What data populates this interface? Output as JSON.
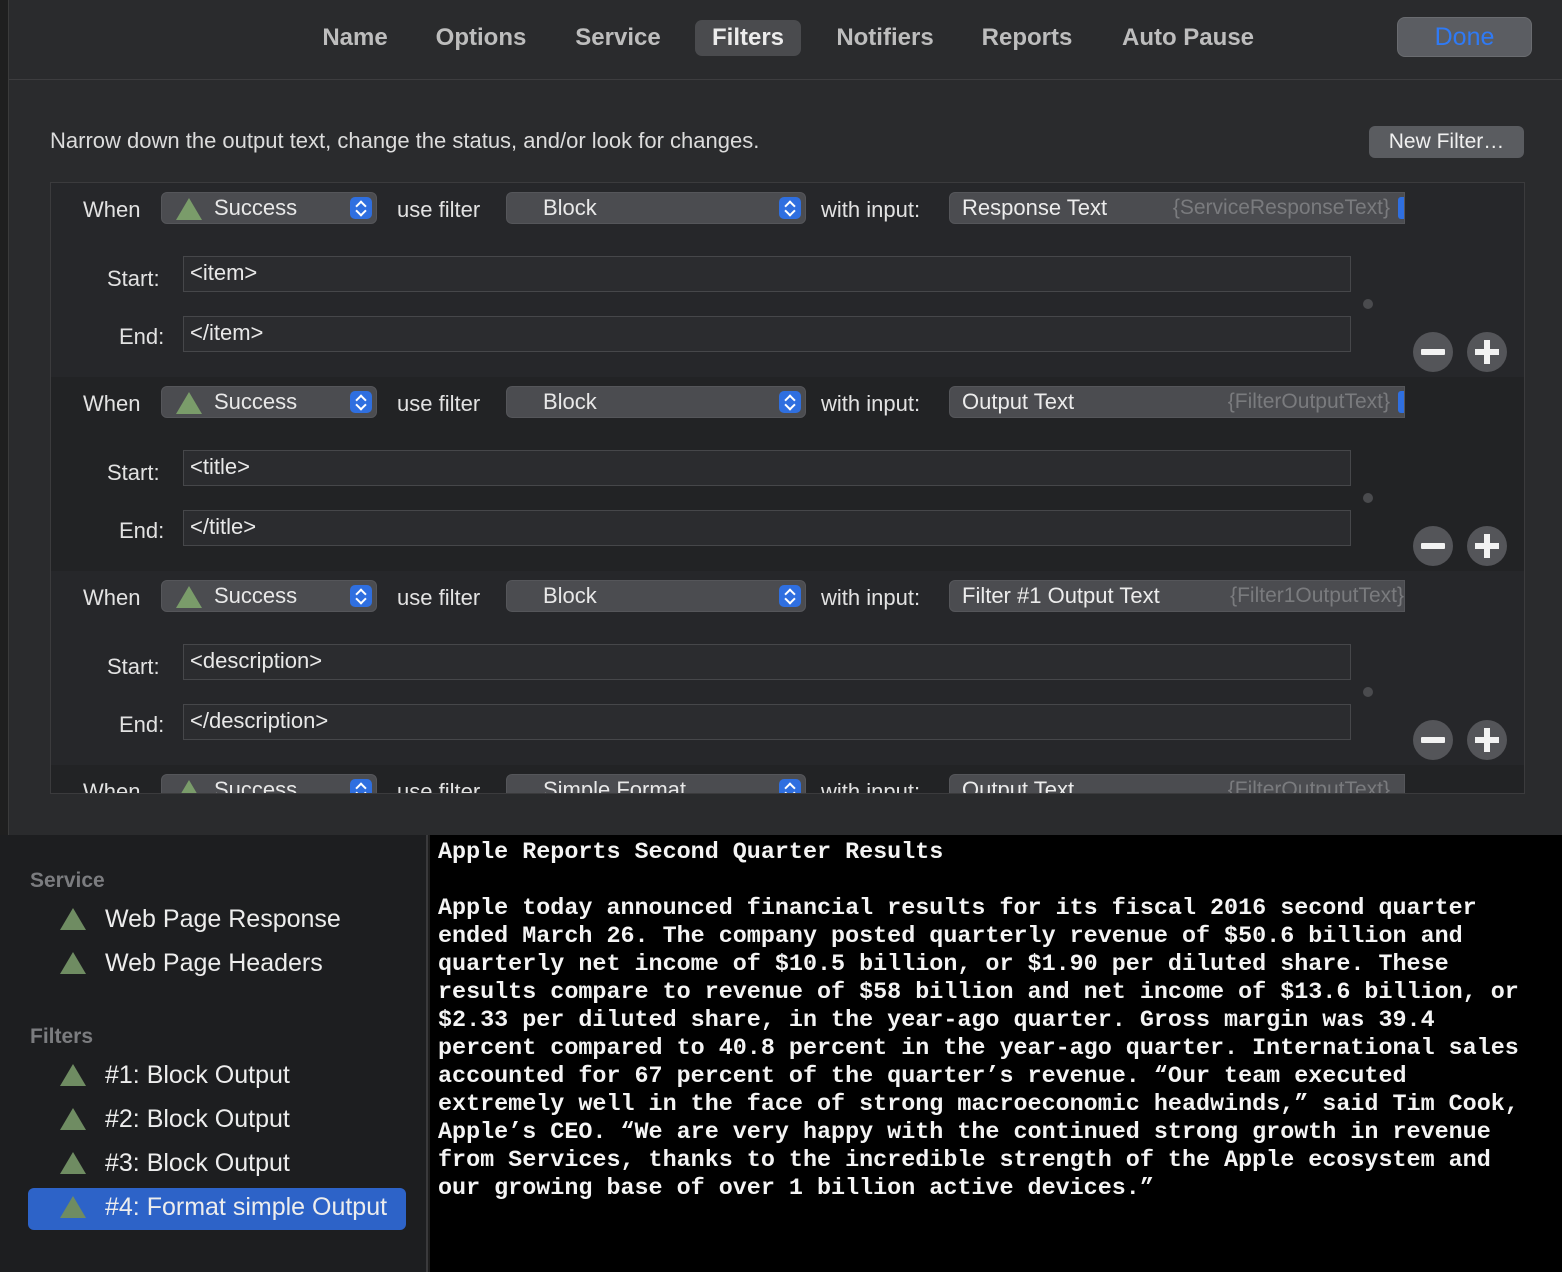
{
  "toolbar": {
    "tabs": [
      {
        "label": "Name"
      },
      {
        "label": "Options"
      },
      {
        "label": "Service"
      },
      {
        "label": "Filters"
      },
      {
        "label": "Notifiers"
      },
      {
        "label": "Reports"
      },
      {
        "label": "Auto Pause"
      }
    ],
    "active_tab": "Filters",
    "done_label": "Done"
  },
  "description": "Narrow down the output text, change the status, and/or look for changes.",
  "new_filter_label": "New Filter…",
  "labels": {
    "when": "When",
    "use_filter": "use filter",
    "with_input": "with input:",
    "start": "Start:",
    "end": "End:"
  },
  "filters": [
    {
      "status": "Success",
      "filter": "Block",
      "input": "Response Text",
      "input_var": "{ServiceResponseText}",
      "start": "<item>",
      "end": "</item>"
    },
    {
      "status": "Success",
      "filter": "Block",
      "input": "Output Text",
      "input_var": "{FilterOutputText}",
      "start": "<title>",
      "end": "</title>"
    },
    {
      "status": "Success",
      "filter": "Block",
      "input": "Filter #1 Output Text",
      "input_var": "{Filter1OutputText}",
      "start": "<description>",
      "end": "</description>"
    },
    {
      "status": "Success",
      "filter": "Simple Format",
      "input": "Output Text",
      "input_var": "{FilterOutputText}"
    }
  ],
  "sidebar": {
    "service_heading": "Service",
    "service_items": [
      {
        "label": "Web Page Response"
      },
      {
        "label": "Web Page Headers"
      }
    ],
    "filters_heading": "Filters",
    "filter_items": [
      {
        "label": "#1: Block Output"
      },
      {
        "label": "#2: Block Output"
      },
      {
        "label": "#3: Block Output"
      },
      {
        "label": "#4: Format simple Output"
      }
    ],
    "selected_index": 3
  },
  "output_text": "Apple Reports Second Quarter Results\n\nApple today announced financial results for its fiscal 2016 second quarter\nended March 26. The company posted quarterly revenue of $50.6 billion and\nquarterly net income of $10.5 billion, or $1.90 per diluted share. These\nresults compare to revenue of $58 billion and net income of $13.6 billion, or\n$2.33 per diluted share, in the year-ago quarter. Gross margin was 39.4\npercent compared to 40.8 percent in the year-ago quarter. International sales\naccounted for 67 percent of the quarter’s revenue. “Our team executed\nextremely well in the face of strong macroeconomic headwinds,” said Tim Cook,\nApple’s CEO. “We are very happy with the continued strong growth in revenue\nfrom Services, thanks to the incredible strength of the Apple ecosystem and\nour growing base of over 1 billion active devices.”",
  "colors": {
    "accent": "#2f6fe0",
    "status_triangle": "#7a9c6a",
    "selection": "#2d63c8"
  }
}
